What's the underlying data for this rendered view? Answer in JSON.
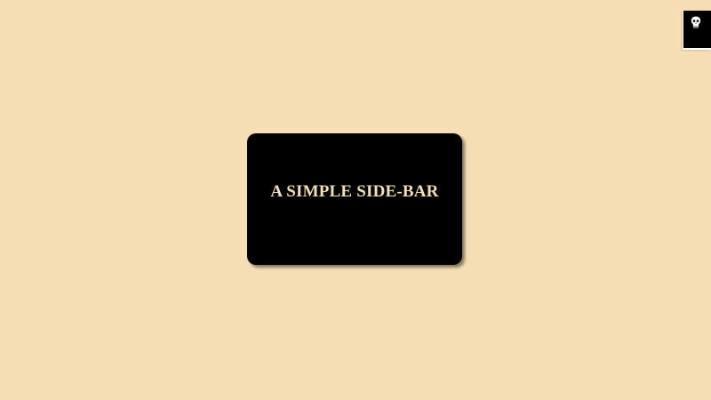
{
  "main": {
    "title": "A SIMPLE SIDE-BAR"
  },
  "sidebar_toggle": {
    "icon": "skull-icon"
  },
  "colors": {
    "background": "#F5DEB3",
    "card": "#000000",
    "title_text": "#F5DEB3"
  }
}
